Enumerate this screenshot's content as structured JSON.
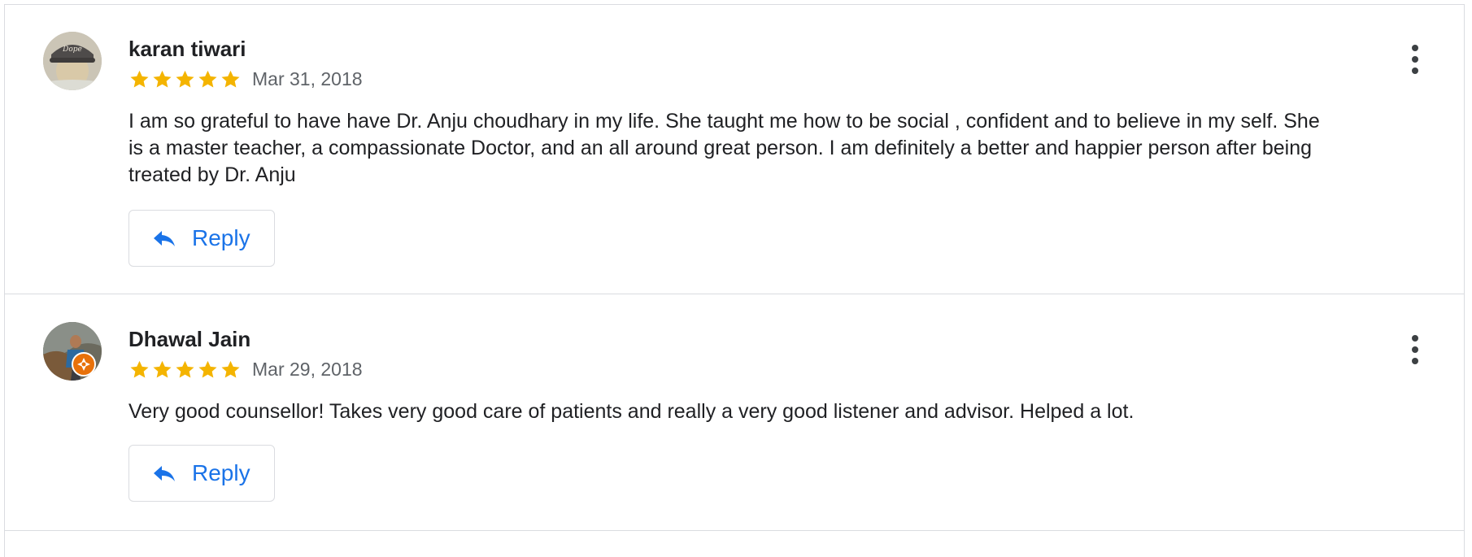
{
  "reviews": [
    {
      "author": "karan tiwari",
      "rating": 5,
      "date": "Mar 31, 2018",
      "text": "I am so grateful to have have Dr. Anju choudhary in my life. She taught me how to be social , confident and to believe in my self. She is a master teacher, a compassionate Doctor, and an all around great person. I am definitely a better and happier person after being treated by Dr. Anju",
      "reply_label": "Reply",
      "avatar_icon": "user-photo",
      "menu_icon": "more-vert-icon"
    },
    {
      "author": "Dhawal Jain",
      "rating": 5,
      "date": "Mar 29, 2018",
      "text": "Very good counsellor! Takes very good care of patients and really a very good listener and advisor. Helped a lot.",
      "reply_label": "Reply",
      "avatar_icon": "user-photo",
      "badge_icon": "local-guide-badge-icon",
      "menu_icon": "more-vert-icon"
    }
  ],
  "colors": {
    "star": "#f4b400",
    "reply_text": "#1a73e8",
    "reply_icon": "#1a73e8",
    "badge": "#e8710a",
    "border": "#dadce0"
  }
}
